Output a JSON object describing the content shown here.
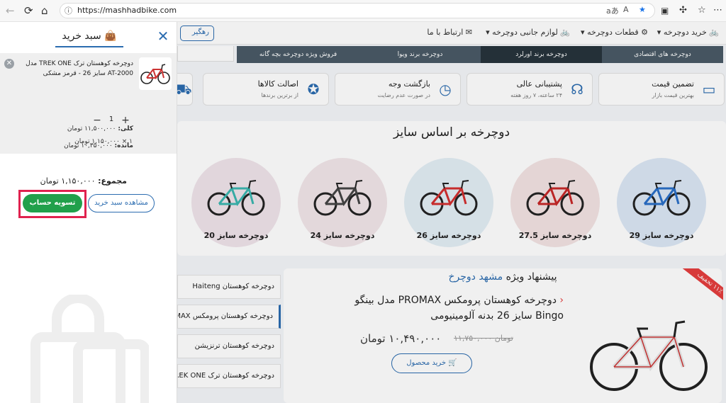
{
  "browser": {
    "url": "https://mashhadbike.com",
    "back_icon": "back-arrow-icon",
    "reload_icon": "reload-icon",
    "home_icon": "home-icon",
    "read_aloud": "aあ",
    "text_size": "A"
  },
  "nav": {
    "items": [
      "خرید دوچرخه",
      "قطعات دوچرخه",
      "لوازم جانبی دوچرخه",
      "ارتباط با ما"
    ],
    "guide_label": "رهگیر"
  },
  "tabs": [
    "دوچرخه های اقتصادی",
    "دوچرخه برند اورلرد",
    "دوچرخه برند ویوا",
    "فروش ویژه دوچرخه بچه گانه"
  ],
  "features": [
    {
      "title": "تضمین قیمت",
      "sub": "بهترین قیمت بازار"
    },
    {
      "title": "پشتیبانی عالی",
      "sub": "۲۴ ساعته، ۷ روز هفته"
    },
    {
      "title": "بازگشت وجه",
      "sub": "در صورت عدم رضایت"
    },
    {
      "title": "اصالت کالاها",
      "sub": "از برترین برندها"
    }
  ],
  "sizes": {
    "title": "دوچرخه بر اساس سایز",
    "items": [
      "دوچرخه سایز 29",
      "دوچرخه سایز 27.5",
      "دوچرخه سایز 26",
      "دوچرخه سایز 24",
      "دوچرخه سایز 20"
    ],
    "colors": [
      "#dbe7f5",
      "#f3e3e3",
      "#e3eef5",
      "#f2e6e9",
      "#f0e4ea"
    ]
  },
  "side_list": [
    "دوچرخه کوهستان Haiteng",
    "دوچرخه کوهستان پرومکس PROMAX",
    "دوچرخه کوهستان ترنزیشن",
    "دوچرخه کوهستان ترک TREK ONE"
  ],
  "offer": {
    "title_prefix": "پیشنهاد ویژه",
    "title_brand": "مشهد دوچرخ",
    "product_name": "دوچرخه کوهستان پرومکس PROMAX مدل بینگو Bingo سایز 26 بدنه آلومینیومی",
    "old_price": "۱۱,۷۵۰,۰۰۰ تومان",
    "new_price": "۱۰,۴۹۰,۰۰۰ تومان",
    "buy_label": "خرید محصول",
    "discount": "۱۱٪ تخفیف"
  },
  "cart": {
    "title": "سبد خرید",
    "product_name": "دوچرخه کوهستان ترک TREK ONE مدل AT-2000 سایز 26 - قرمز مشکی",
    "quantity": "1",
    "total_label": "کلی:",
    "total_value": "۱۱,۵۰۰,۰۰۰ تومان",
    "remaining_label": "مانده:",
    "remaining_value": "۱۰,۳۵۰,۰۰۰ تومان",
    "unit_line": "۱ × ۱,۱۵۰,۰۰۰ تومان",
    "sum_label": "مجموع:",
    "sum_value": "۱,۱۵۰,۰۰۰ تومان",
    "view_cart": "مشاهده سبد خرید",
    "checkout": "تسویه حساب"
  },
  "colors": {
    "accent": "#2b6cb0",
    "checkout": "#21a04b",
    "highlight_border": "#e0224f"
  }
}
